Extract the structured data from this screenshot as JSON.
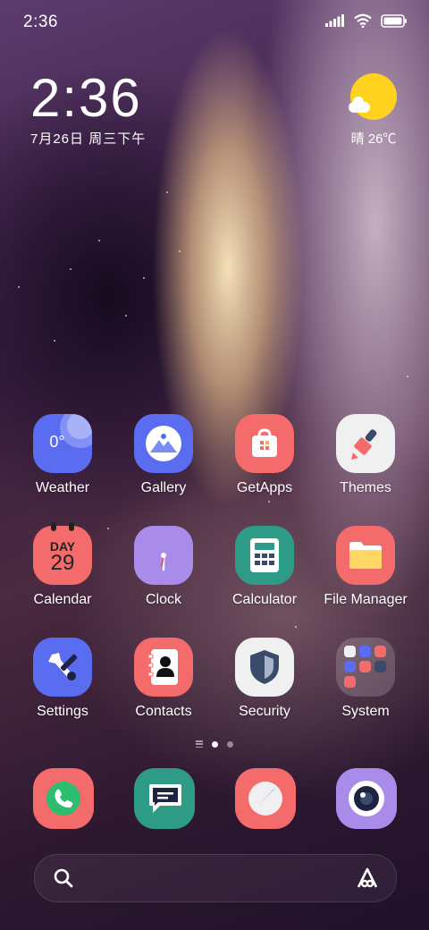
{
  "status_bar": {
    "time": "2:36"
  },
  "clock_widget": {
    "time": "2:36",
    "date": "7月26日 周三下午"
  },
  "weather_widget": {
    "temp": "晴 26℃"
  },
  "weather_icon_text": "0°",
  "calendar_icon": {
    "day": "DAY",
    "num": "29"
  },
  "apps": [
    {
      "label": "Weather"
    },
    {
      "label": "Gallery"
    },
    {
      "label": "GetApps"
    },
    {
      "label": "Themes"
    },
    {
      "label": "Calendar"
    },
    {
      "label": "Clock"
    },
    {
      "label": "Calculator"
    },
    {
      "label": "File Manager"
    },
    {
      "label": "Settings"
    },
    {
      "label": "Contacts"
    },
    {
      "label": "Security"
    },
    {
      "label": "System"
    }
  ],
  "dock": [
    {
      "icon": "phone-icon"
    },
    {
      "icon": "messages-icon"
    },
    {
      "icon": "browser-icon"
    },
    {
      "icon": "camera-icon"
    }
  ],
  "colors": {
    "weather": "#5a6cf0",
    "gallery": "#5a6cf0",
    "getapps": "#f36b6b",
    "themes": "#f0f0f0",
    "calendar": "#f36b6b",
    "clock": "#a98bea",
    "calculator": "#2d9b86",
    "filemanager": "#f36b6b",
    "settings": "#5a6cf0",
    "contacts": "#f36b6b",
    "security": "#f0f0f0"
  }
}
